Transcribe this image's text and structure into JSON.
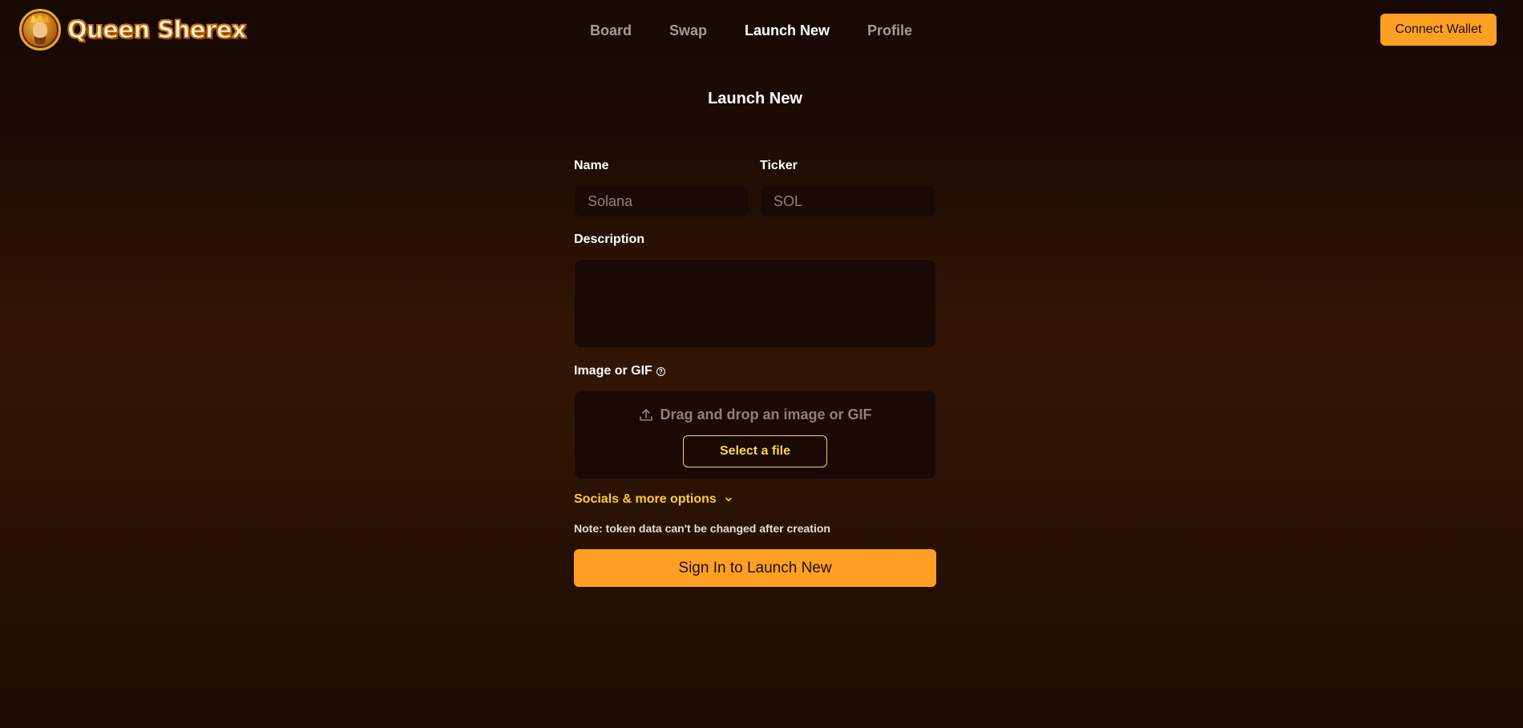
{
  "brand": {
    "name": "Queen Sherex"
  },
  "nav": {
    "items": [
      {
        "label": "Board"
      },
      {
        "label": "Swap"
      },
      {
        "label": "Launch New",
        "active": true
      },
      {
        "label": "Profile"
      }
    ]
  },
  "header": {
    "connect_label": "Connect Wallet"
  },
  "form": {
    "title": "Launch New",
    "name_label": "Name",
    "name_placeholder": "Solana",
    "ticker_label": "Ticker",
    "ticker_placeholder": "SOL",
    "description_label": "Description",
    "description_value": "",
    "image_label": "Image or GIF",
    "dropzone_text": "Drag and drop an image or GIF",
    "select_file_label": "Select a file",
    "socials_label": "Socials & more options",
    "note": "Note: token data can't be changed after creation",
    "submit_label": "Sign In to Launch New"
  },
  "colors": {
    "accent": "#ffa025",
    "highlight": "#ffd54a",
    "socials": "#ffcc2e"
  },
  "icons": {
    "upload": "upload-icon",
    "info": "info-icon",
    "chevron": "chevron-down-icon"
  }
}
